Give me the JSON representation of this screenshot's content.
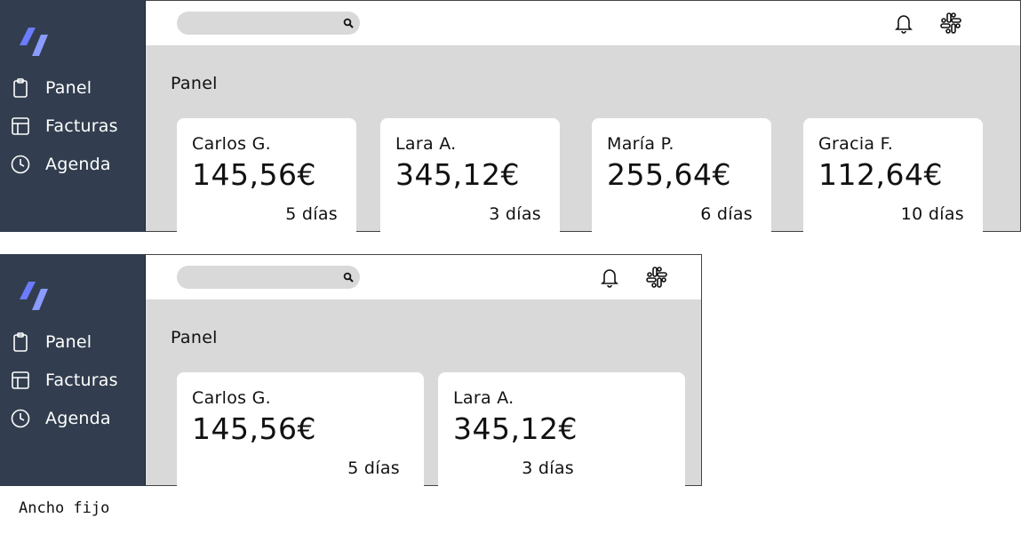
{
  "nav": [
    "Panel",
    "Facturas",
    "Agenda"
  ],
  "search": {
    "placeholder": ""
  },
  "page_title": "Panel",
  "cards": [
    {
      "name": "Carlos G.",
      "amount": "145,56€",
      "days": "5 días"
    },
    {
      "name": "Lara A.",
      "amount": "345,12€",
      "days": "3 días"
    },
    {
      "name": "María P.",
      "amount": "255,64€",
      "days": "6 días"
    },
    {
      "name": "Gracia F.",
      "amount": "112,64€",
      "days": "10 días"
    }
  ],
  "caption": "Ancho fijo",
  "colors": {
    "sidebar": "#323e4f",
    "content_bg": "#d9d9d9",
    "logo_accent": "#6b7cff"
  }
}
